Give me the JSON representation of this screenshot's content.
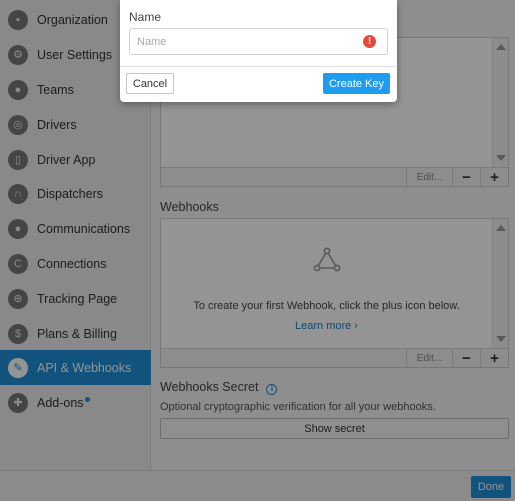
{
  "sidebar": {
    "items": [
      {
        "label": "Organization",
        "icon": "briefcase-icon"
      },
      {
        "label": "User Settings",
        "icon": "gear-icon"
      },
      {
        "label": "Teams",
        "icon": "people-icon"
      },
      {
        "label": "Drivers",
        "icon": "steering-wheel-icon"
      },
      {
        "label": "Driver App",
        "icon": "phone-icon"
      },
      {
        "label": "Dispatchers",
        "icon": "headset-icon"
      },
      {
        "label": "Communications",
        "icon": "chat-bubble-icon"
      },
      {
        "label": "Connections",
        "icon": "connections-icon"
      },
      {
        "label": "Tracking Page",
        "icon": "target-icon"
      },
      {
        "label": "Plans & Billing",
        "icon": "dollar-icon"
      },
      {
        "label": "API & Webhooks",
        "icon": "wrench-icon"
      },
      {
        "label": "Add-ons",
        "icon": "puzzle-icon"
      }
    ],
    "active_label": "API & Webhooks"
  },
  "api_keys_panel": {
    "toolbar": {
      "edit": "Edit...",
      "minus": "−",
      "plus": "+"
    }
  },
  "webhooks": {
    "title": "Webhooks",
    "empty_message": "To create your first Webhook, click the plus icon below.",
    "learn_more": "Learn more ›",
    "toolbar": {
      "edit": "Edit...",
      "minus": "−",
      "plus": "+"
    }
  },
  "webhooks_secret": {
    "title": "Webhooks Secret",
    "info_icon": "i",
    "description": "Optional cryptographic verification for all your webhooks.",
    "button": "Show secret"
  },
  "footer": {
    "done": "Done"
  },
  "modal": {
    "field_label": "Name",
    "name_placeholder": "Name",
    "name_value": "",
    "error_icon": "!",
    "cancel": "Cancel",
    "create": "Create Key"
  },
  "colors": {
    "accent": "#1e8fd8",
    "create_button": "#1e9cf0",
    "error": "#e04b3c"
  }
}
